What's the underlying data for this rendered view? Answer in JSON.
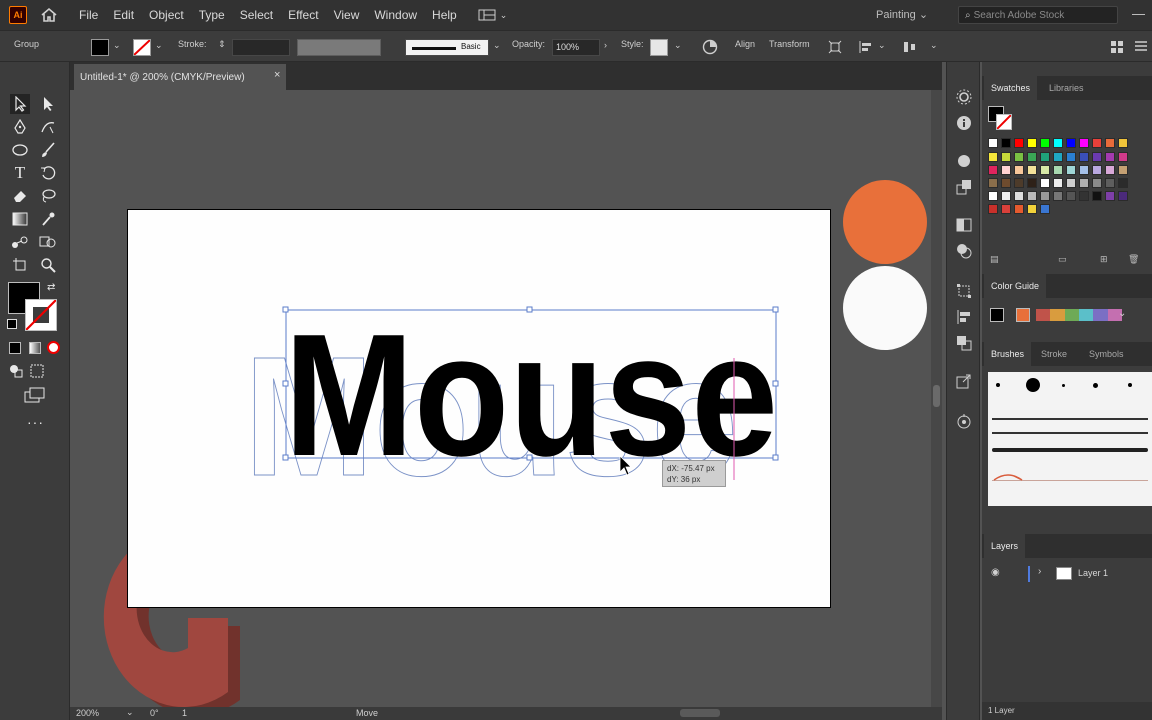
{
  "app": {
    "logo_text": "Ai"
  },
  "menu": [
    "File",
    "Edit",
    "Object",
    "Type",
    "Select",
    "Effect",
    "View",
    "Window",
    "Help"
  ],
  "workspace": "Painting",
  "search": {
    "placeholder": "Search Adobe Stock"
  },
  "control_bar": {
    "selection": "Group",
    "stroke_label": "Stroke:",
    "brush_label": "Basic",
    "opacity_label": "Opacity:",
    "opacity_value": "100%",
    "style_label": "Style:",
    "align": "Align",
    "transform": "Transform"
  },
  "document": {
    "tab_title": "Untitled-1* @ 200% (CMYK/Preview)",
    "close": "×"
  },
  "artwork": {
    "text": "Mouse",
    "ghost_text": "Mouse"
  },
  "move_tooltip": {
    "dx": "dX: -75.47 px",
    "dy": "dY: 36 px"
  },
  "status": {
    "zoom": "200%",
    "angle": "0°",
    "artboard": "1",
    "tool": "Move"
  },
  "panels": {
    "swatches_tabs": [
      "Swatches",
      "Libraries"
    ],
    "color_guide": "Color Guide",
    "brushes_tabs": [
      "Brushes",
      "Stroke",
      "Symbols"
    ],
    "layers_tab": "Layers",
    "layer_name": "Layer 1",
    "layer_count": "1 Layer"
  },
  "colors": {
    "accent_orange": "#E8703A",
    "white_circle": "#FAFAFA",
    "artboard": "#FEFEFE",
    "selection_blue": "#5B7CC9"
  }
}
